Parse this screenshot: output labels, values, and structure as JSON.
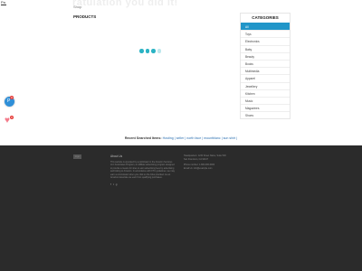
{
  "header": {
    "logo_text": "Pa",
    "headline": "ratulation you did it!",
    "breadcrumb": "Shop"
  },
  "products": {
    "title": "PRODUCTS"
  },
  "categories": {
    "title": "CATEGORIES",
    "items": [
      {
        "label": "All",
        "active": true
      },
      {
        "label": "Toys"
      },
      {
        "label": "Electronics"
      },
      {
        "label": "Baby"
      },
      {
        "label": "Beauty"
      },
      {
        "label": "Books"
      },
      {
        "label": "Multimedia"
      },
      {
        "label": "Apparel"
      },
      {
        "label": "Jewellery"
      },
      {
        "label": "Kitchen"
      },
      {
        "label": "Music"
      },
      {
        "label": "Magazines"
      },
      {
        "label": "Shoes"
      }
    ]
  },
  "fabs": {
    "cart_glyph": "P",
    "cart_badge": "0",
    "wishlist_badge": "0"
  },
  "recent_searches": {
    "label": "Recent Searched Items:",
    "links": "Hosting | seller | north face | mountblanc | sun shirt |"
  },
  "footer": {
    "logo_alt": "logo",
    "about_heading": "About Us",
    "about_text": "This website is operated by a participant in the Amazon Services LLC Associates Program, an affiliate advertising program designed to provide a means for sites to earn advertising fees by advertising and linking to Amazon. In accordance with FTC guidelines, we may earn a commission when you click on the links provided. As an Amazon Associate we earn from qualifying purchases.",
    "social": [
      "f",
      "t",
      "g"
    ],
    "address_line1": "Headquarters: 1234 Street Name, Suite 500",
    "address_line2": "San Francisco, CA 94107",
    "phone": "Phone number: 1-800-000-0000",
    "email": "Email Us: info@example.com"
  },
  "colors": {
    "accent": "#2bb3c4",
    "category_active": "#2196c9",
    "footer_bg": "#2b2b2b",
    "link": "#2a6fb0"
  }
}
